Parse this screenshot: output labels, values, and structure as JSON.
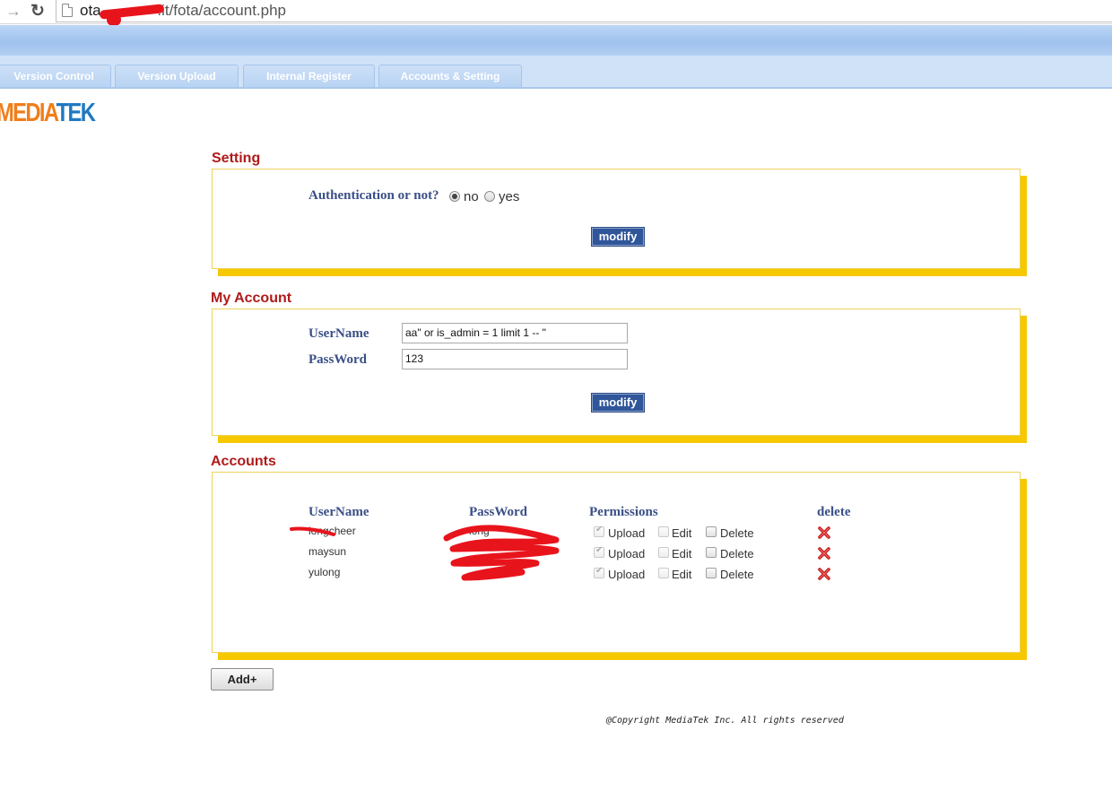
{
  "browser": {
    "url_prefix": "ota.",
    "url_suffix": ".it/fota/account.php"
  },
  "tabs": [
    {
      "label": "Version Control"
    },
    {
      "label": "Version Upload"
    },
    {
      "label": "Internal Register"
    },
    {
      "label": "Accounts & Setting"
    }
  ],
  "logo": {
    "part1": "MEDIA",
    "part2": "TEK"
  },
  "setting": {
    "title": "Setting",
    "auth_label": "Authentication or not?",
    "opt_no": "no",
    "opt_yes": "yes",
    "selected": "no",
    "modify_label": "modify"
  },
  "my_account": {
    "title": "My Account",
    "username_label": "UserName",
    "password_label": "PassWord",
    "username_value": "aa\" or is_admin = 1 limit 1 -- \"",
    "password_value": "123",
    "modify_label": "modify"
  },
  "accounts": {
    "title": "Accounts",
    "headers": {
      "username": "UserName",
      "password": "PassWord",
      "permissions": "Permissions",
      "delete": "delete"
    },
    "perm_labels": {
      "upload": "Upload",
      "edit": "Edit",
      "delete": "Delete"
    },
    "rows": [
      {
        "username": "longcheer",
        "password": "long",
        "upload": true,
        "edit": false,
        "delete": false
      },
      {
        "username": "maysun",
        "password": "",
        "upload": true,
        "edit": false,
        "delete": false
      },
      {
        "username": "yulong",
        "password": "",
        "upload": true,
        "edit": false,
        "delete": false
      }
    ]
  },
  "add_label": "Add+",
  "copyright": "@Copyright MediaTek Inc. All rights reserved",
  "colors": {
    "section_title": "#b01a1a",
    "label_blue": "#3a4f86",
    "panel_shadow": "#f5c800",
    "button_blue": "#30569a"
  }
}
